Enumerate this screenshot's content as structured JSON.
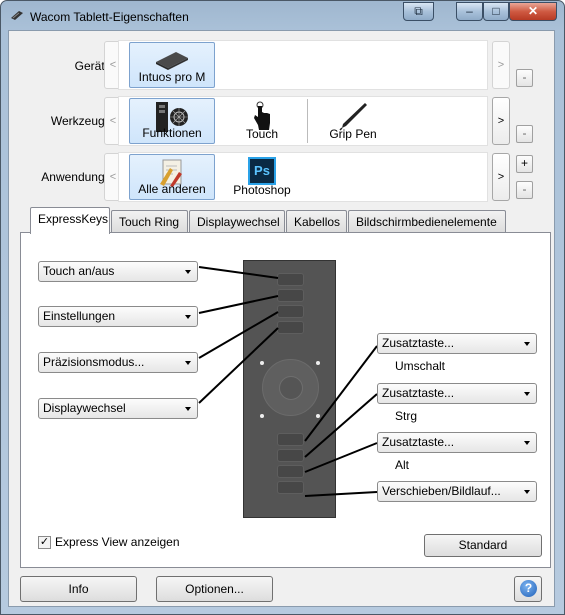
{
  "window": {
    "title": "Wacom Tablett-Eigenschaften",
    "restore_glyph": "⧉",
    "minimize_glyph": "–",
    "maximize_glyph": "□",
    "close_glyph": "✕"
  },
  "rows": {
    "geraet": {
      "label": "Gerät:",
      "items": [
        "Intuos pro M"
      ]
    },
    "werkzeug": {
      "label": "Werkzeug:",
      "items": [
        "Funktionen",
        "Touch",
        "Grip Pen"
      ]
    },
    "anwendung": {
      "label": "Anwendung:",
      "items": [
        "Alle anderen",
        "Photoshop"
      ]
    },
    "left_arrow": "<",
    "right_arrow": ">",
    "minus": "-",
    "plus": "+"
  },
  "tabs": [
    "ExpressKeys",
    "Touch Ring",
    "Displaywechsel",
    "Kabellos",
    "Bildschirmbedienelemente"
  ],
  "left_combos": [
    "Touch an/aus",
    "Einstellungen",
    "Präzisionsmodus...",
    "Displaywechsel"
  ],
  "right_combos": [
    {
      "value": "Zusatztaste...",
      "sub": "Umschalt"
    },
    {
      "value": "Zusatztaste...",
      "sub": "Strg"
    },
    {
      "value": "Zusatztaste...",
      "sub": "Alt"
    },
    {
      "value": "Verschieben/Bildlauf...",
      "sub": ""
    }
  ],
  "checkbox": {
    "label": "Express View anzeigen",
    "checked": true,
    "mark": "✓"
  },
  "buttons": {
    "standard": "Standard",
    "info": "Info",
    "optionen": "Optionen...",
    "help": "?"
  },
  "icons": {
    "photoshop": "Ps"
  }
}
